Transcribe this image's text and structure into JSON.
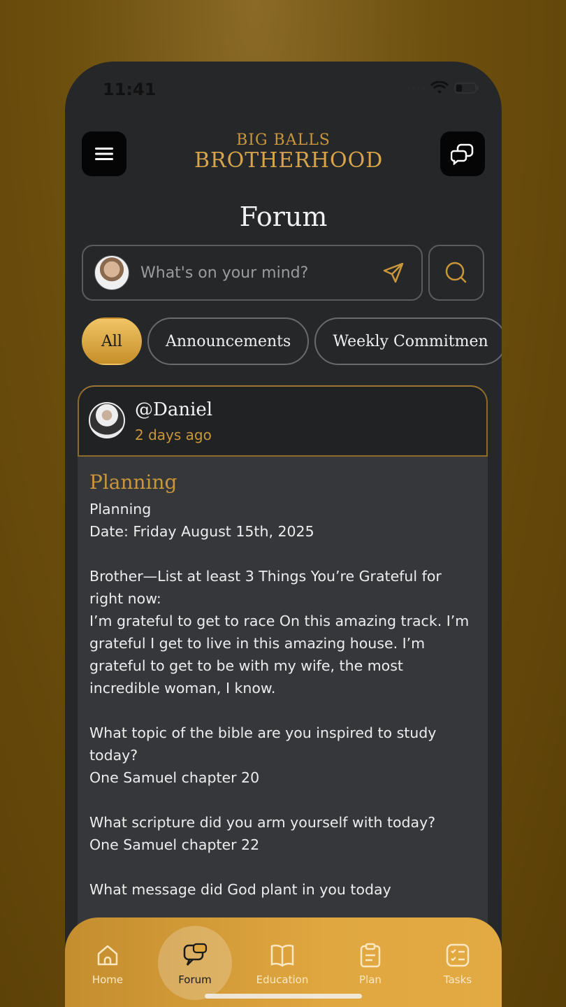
{
  "status_bar": {
    "time": "11:41"
  },
  "header": {
    "logo_line1": "BIG BALLS",
    "logo_line2": "BROTHERHOOD",
    "menu_icon": "hamburger-menu-icon",
    "chat_icon": "chat-bubbles-icon"
  },
  "page": {
    "title": "Forum"
  },
  "composer": {
    "placeholder": "What's on your mind?"
  },
  "filters": [
    {
      "label": "All",
      "active": true
    },
    {
      "label": "Announcements",
      "active": false
    },
    {
      "label": "Weekly Commitmen",
      "active": false
    }
  ],
  "post": {
    "username": "@Daniel",
    "time_ago": "2 days ago",
    "title": "Planning",
    "body": "Planning\nDate: Friday August 15th, 2025\n\nBrother—List at least 3 Things You’re Grateful for right now:\nI’m grateful to get to race On this amazing track. I’m grateful I get to live in this amazing house. I’m grateful to get to be with my wife, the most incredible woman, I know.\n\nWhat topic of the bible are you inspired to study today?\nOne Samuel chapter 20\n\nWhat scripture did you arm yourself with today?\nOne Samuel chapter 22\n\nWhat message did God plant in you today"
  },
  "tabs": [
    {
      "label": "Home",
      "icon": "home-icon"
    },
    {
      "label": "Forum",
      "icon": "forum-icon",
      "active": true
    },
    {
      "label": "Education",
      "icon": "book-icon"
    },
    {
      "label": "Plan",
      "icon": "clipboard-icon"
    },
    {
      "label": "Tasks",
      "icon": "checklist-icon"
    }
  ],
  "colors": {
    "accent": "#c9963a",
    "background": "#262729",
    "tabbar": "#e0a740"
  }
}
